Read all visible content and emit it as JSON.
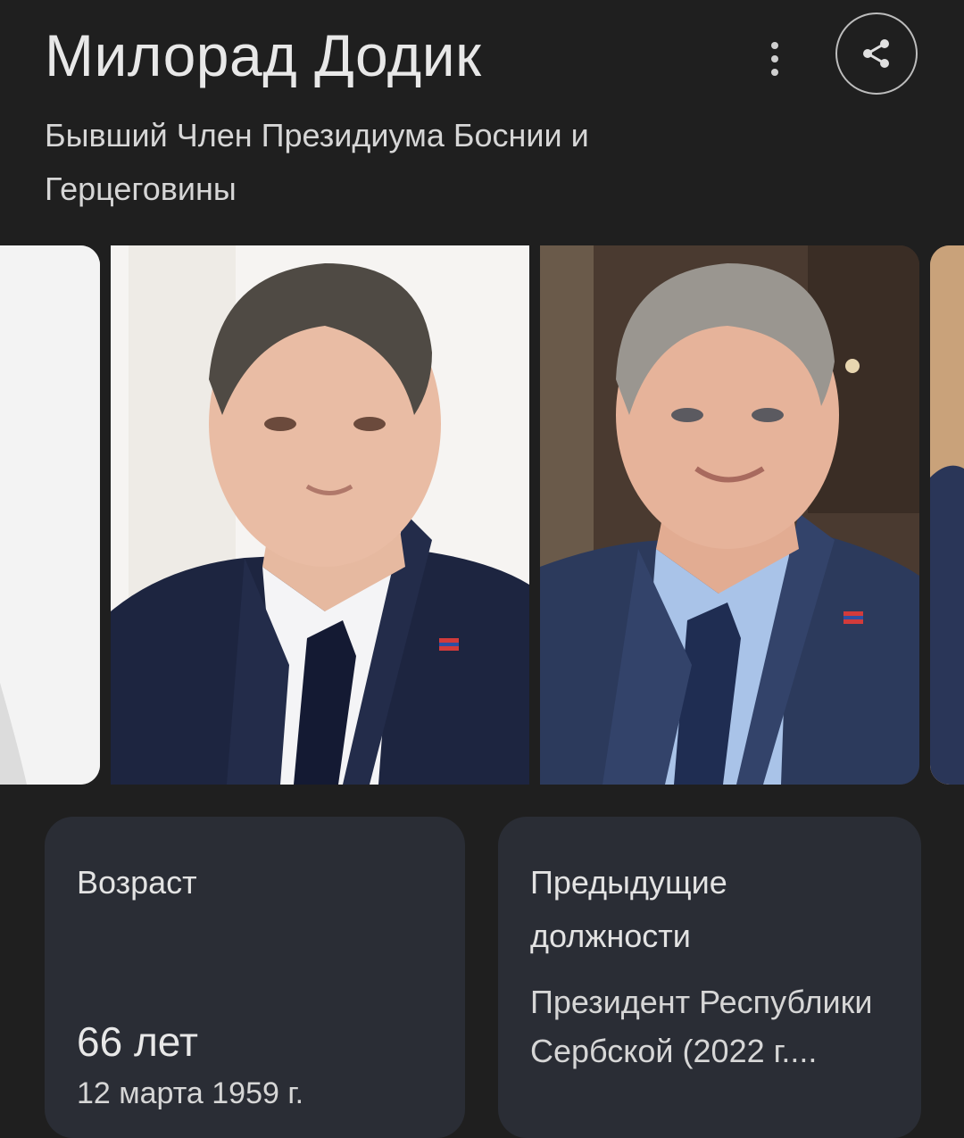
{
  "header": {
    "title": "Милорад Додик",
    "subtitle": "Бывший Член Президиума Боснии и Герцеговины",
    "more_icon": "more-vert-icon",
    "share_icon": "share-icon"
  },
  "facts": {
    "age": {
      "label": "Возраст",
      "value": "66 лет",
      "birth_date": "12 марта 1959 г."
    },
    "previous_positions": {
      "label": "Предыдущие должности",
      "value": "Президент Республики Сербской (2022 г...."
    }
  },
  "colors": {
    "background": "#1f1f1f",
    "card": "#2a2d35",
    "text": "#e3e3e3"
  }
}
